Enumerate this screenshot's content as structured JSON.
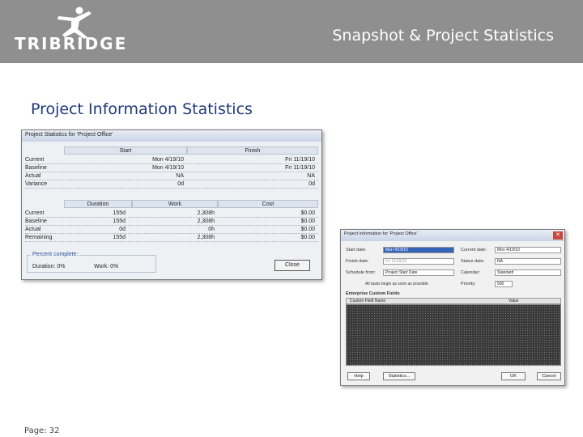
{
  "header": {
    "logo_text": "TRIBRIDGE",
    "title": "Snapshot & Project Statistics"
  },
  "section_title": "Project Information Statistics",
  "stats_dialog": {
    "title": "Project Statistics for 'Project Office'",
    "top_headers": [
      "Start",
      "Finish"
    ],
    "top_rows": [
      {
        "label": "Current",
        "start": "Mon 4/19/10",
        "finish": "Fri 11/19/10"
      },
      {
        "label": "Baseline",
        "start": "Mon 4/19/10",
        "finish": "Fri 11/19/10"
      },
      {
        "label": "Actual",
        "start": "NA",
        "finish": "NA"
      },
      {
        "label": "Variance",
        "start": "0d",
        "finish": "0d"
      }
    ],
    "bottom_headers": [
      "Duration",
      "Work",
      "Cost"
    ],
    "bottom_rows": [
      {
        "label": "Current",
        "duration": "155d",
        "work": "2,308h",
        "cost": "$0.00"
      },
      {
        "label": "Baseline",
        "duration": "155d",
        "work": "2,308h",
        "cost": "$0.00"
      },
      {
        "label": "Actual",
        "duration": "0d",
        "work": "0h",
        "cost": "$0.00"
      },
      {
        "label": "Remaining",
        "duration": "155d",
        "work": "2,308h",
        "cost": "$0.00"
      }
    ],
    "percent_complete": {
      "legend": "Percent complete:",
      "duration": "Duration: 0%",
      "work": "Work: 0%"
    },
    "close_label": "Close"
  },
  "info_dialog": {
    "title": "Project Information for 'Project Office'",
    "start_date_label": "Start date:",
    "start_date_value": "Mon 4/19/10",
    "finish_date_label": "Finish date:",
    "finish_date_value": "Fri 11/19/10",
    "schedule_from_label": "Schedule from:",
    "schedule_from_value": "Project Start Date",
    "note": "All tasks begin as soon as possible.",
    "current_date_label": "Current date:",
    "current_date_value": "Mon 4/19/10",
    "status_date_label": "Status date:",
    "status_date_value": "NA",
    "calendar_label": "Calendar:",
    "calendar_value": "Standard",
    "priority_label": "Priority:",
    "priority_value": "500",
    "enterprise_label": "Enterprise Custom Fields",
    "col_field_name": "Custom Field Name",
    "col_value": "Value",
    "help_label": "Help",
    "statistics_label": "Statistics...",
    "ok_label": "OK",
    "cancel_label": "Cancel"
  },
  "footer": {
    "page": "Page: 32"
  },
  "colors": {
    "header_band": "#8f8f8f",
    "section_title": "#1f3a7a"
  }
}
